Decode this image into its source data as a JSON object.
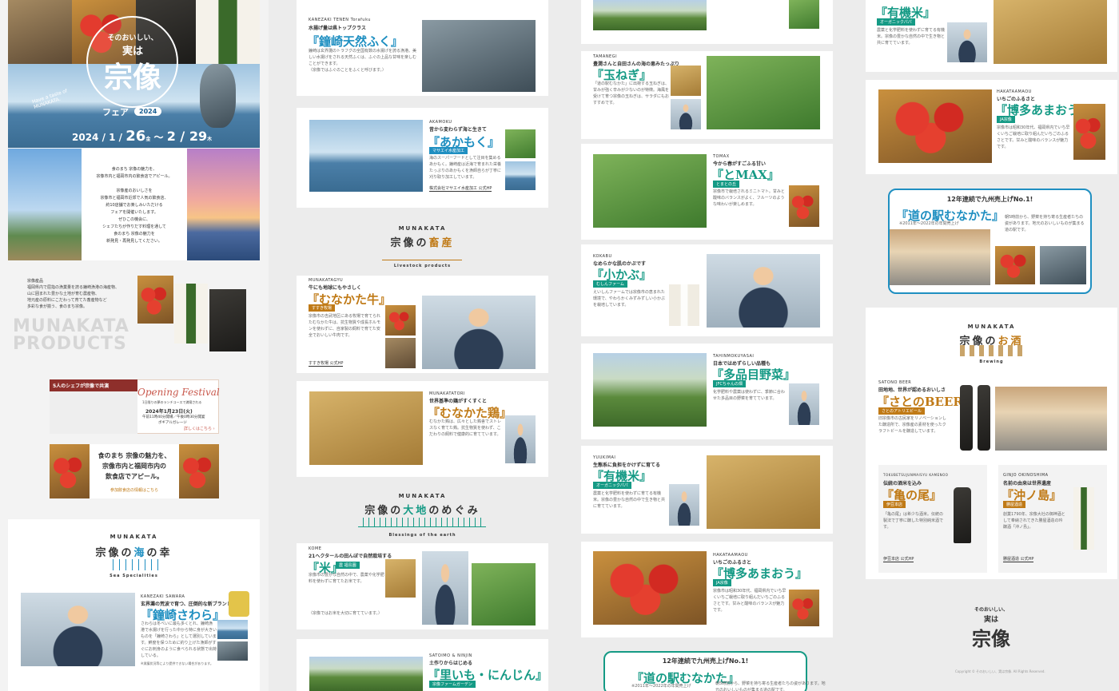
{
  "hero": {
    "catch": "そのおいしい、",
    "jitsuha": "実は",
    "munakata": "宗像",
    "fair": "フェア",
    "year": "2024",
    "date1": "2024 / 1",
    "date2": "26",
    "dow1": "金",
    "sep": "〜",
    "date3": "2 / 29",
    "dow2": "木",
    "taste": "Have a taste of MUNAKATA."
  },
  "intro": {
    "lines": [
      "食のまち 宗像の魅力を、",
      "宗像市内と福岡市内の飲食店でアピール。",
      "",
      "宗像産のおいしさを",
      "宗像市と福岡市近郊で人気の飲食店、",
      "約10店舗でお楽しみいただける",
      "フェアを開催いたします。",
      "ぜひこの機会に、",
      "シェフたちが作りだす料理を通して",
      "食のまち 宗像の魅力を",
      "新発見・再発見してください。"
    ]
  },
  "products": {
    "label": "宗像産品",
    "text": [
      "福岡県内で屈指の漁業量を誇る鐘崎漁港の海産物、",
      "山に囲まれた豊かな土地が育む農産物、",
      "地元産の原料にこだわって育てた畜産物など",
      "多彩な食が揃う、食のまち宗像。"
    ],
    "big1": "MUNAKATA",
    "big2": "PRODUCTS"
  },
  "banner1": {
    "chefs": "5人のシェフが宗像で共演",
    "event": "Opening Festival",
    "sub": "1日限りの夢のランチコースで満喫される",
    "date": "2024年1月23日",
    "dow": "火",
    "time": "午前11時40分開場／午後0時30分開宴",
    "venue": "ボギアルガレージ",
    "more": "詳しくはこちら ›"
  },
  "banner2": {
    "l1": "食のまち 宗像の魅力を、",
    "l2": "宗像市内と福岡市内の",
    "l3": "飲食店でアピール。",
    "more": "参加飲食店の情報はこちら"
  },
  "sea": {
    "en": "MUNAKATA",
    "jp1": "宗像の",
    "jp2": "海",
    "jp3": "の幸",
    "sub": "Sea Specialities"
  },
  "sawara": {
    "roman": "KANEZAKI SAWARA",
    "catch": "玄界灘の荒波で育つ、圧倒的な新ブランド",
    "name": "『鐘崎さわら』",
    "text": "さわらは冬べいに最も多くとれ、鐘崎漁港で水揚げを行った中から特に身が大きいものを「鐘崎さわら」として選別しています。鮮度を保つために釣り上げた漁師がすぐにお刺身のように食べられる状態で出荷している。",
    "note": "※漁獲状況等により提供できない場合があります。"
  },
  "fugu": {
    "roman": "KANEZAKI TENEN Torafuku",
    "catch": "水揚げ量は県トップクラス",
    "name": "『鐘崎天然ふく』",
    "text": "鐘崎は玄界灘のトラフグの全国有数の水揚げを誇る漁港。美しい水揚げをされる天然ふくは、ふぐの上品な甘味を楽しむことができます。",
    "note": "（宗像ではふぐのことをふくと呼びます。）"
  },
  "akamoku": {
    "roman": "AKAMOKU",
    "catch": "昔から変わらず海と生きて",
    "name": "『あかもく』",
    "badge": "マサエイ水産加工",
    "text": "海のスーパーフードとして注目を集めるあかもく。鐘崎産は近海で育まれた栄養たっぷりのあかもくを漁師自らが丁寧に刈り取り加工しています。",
    "link": "株式会社マサエイ水産加工 公式HP"
  },
  "livestock": {
    "en": "MUNAKATA",
    "jp1": "宗像の",
    "jp2": "畜産",
    "sub": "Livestock products"
  },
  "gyu": {
    "roman": "MUNAKATAGYU",
    "catch": "牛にも地球にもやさしく",
    "name": "『むなかた牛』",
    "badge": "すすき牧場",
    "text": "宗像市の吉武地区にある牧場で育てられたむなかた牛は、抗生物質や成長ホルモンを使わずに、自家製の飼料で育てた安全でおいしい牛肉です。",
    "link": "すすき牧場 公式HP"
  },
  "tori": {
    "roman": "MUNAKATATORI",
    "catch": "世界基準の鶏がすくすくと",
    "name": "『むなかた鶏』",
    "text": "むなかた鶏は、広々とした鶏舎でストレスなく育てた鶏。抗生物質を使わず、こだわりの飼料で健康的に育てています。"
  },
  "earth": {
    "en": "MUNAKATA",
    "jp1": "宗像の",
    "jp2": "大地",
    "jp3": "のめぐみ",
    "sub": "Blessings of the earth"
  },
  "kome": {
    "roman": "KOME",
    "catch": "21ヘクタールの田んぼで自然栽培する",
    "name": "『米』",
    "badge": "農 福島園",
    "text": "宗像市の豊かな自然の中で、農薬や化学肥料を使わずに育てたお米です。",
    "note": "（宗像ではお米を大切に育てています。）"
  },
  "satoimo": {
    "roman": "SATOIMO & NINJIN",
    "catch": "土作りからはじめる",
    "name": "『里いも・にんじん』",
    "badge": "宗像ファームガーデン"
  },
  "tamanegi": {
    "roman": "TAMANEGI",
    "catch": "豊潤さんと自田さんの海の恵みたっぷり",
    "name": "『玉ねぎ』",
    "text": "「道の駅むなかた」に出荷する玉ねぎは、甘みが強く辛みが少ないのが特徴。海風を受けて育つ宗像の玉ねぎは、サラダにもおすすめです。"
  },
  "tomax": {
    "roman": "TOMAX",
    "catch": "今から春がすごふる甘い",
    "name": "『とMAX』",
    "badge": "とまとの丘",
    "text": "宗像市で栽培されるミニトマト。甘みと酸味のバランスがよく、フルーツのような味わいが楽しめます。"
  },
  "kokabu": {
    "roman": "KOKABU",
    "catch": "なめらかな肌のかぶです",
    "name": "『小かぶ』",
    "badge": "むしんファーム",
    "text": "えいしんファームでは宗像市の恵まれた環境で、やわらかくみずみずしい小かぶを栽培しています。"
  },
  "tahinmoku": {
    "roman": "TAHINMOKUYASAI",
    "catch": "日本ではめずらしい品種も",
    "name": "『多品目野菜』",
    "badge": "JFCちゃんの畑",
    "text": "化学肥料や農薬は使わずに、季節に合わせた多品目の野菜を育てています。"
  },
  "yukimai": {
    "roman": "YUUKIMAI",
    "catch": "生態系に負担をかけずに育てる",
    "name": "『有機米』",
    "badge": "オーガニックパパ",
    "text": "農薬と化学肥料を使わずに育てる有機米。宗像の豊かな自然の中で生き物と共に育てています。"
  },
  "amaou": {
    "roman": "HAKATAAMAOU",
    "catch": "いちごのふるさと",
    "name": "『博多あまおう』",
    "badge": "JA宗像",
    "text": "宗像市は昭和30年代、福岡県内でいち早くいちご栽培に取り組んだいちごのふるさとです。甘みと酸味のバランスが魅力です。"
  },
  "michi": {
    "top": "12年連続で九州売上げNo.1!",
    "name": "『道の駅むなかた』",
    "note": "※2011年〜2022年の年間売上げ",
    "text": "朝5時前から、野菜を持ち寄る生産者たちの姿があります。地元のおいしいものが集まる道の駅です。"
  },
  "sake": {
    "en": "MUNAKATA",
    "jp1": "宗像の",
    "jp2": "お酒",
    "sub": "Brewing"
  },
  "beer": {
    "roman": "SATONO BEER",
    "catch": "田地地、世界が認めるおいしさ",
    "name": "『さとのBEER』",
    "badge": "さとのアトリエビール",
    "text": "旧宗像市の古民家をリノベーションした醸造所で、宗像産の素材を使ったクラフトビールを醸造しています。"
  },
  "kamenoo": {
    "roman": "TOKUBETSUJUNMAISYU KAMENOO",
    "catch": "伝統の酒米を込み",
    "name": "『亀の尾』",
    "badge": "伊豆本店",
    "text": "「亀の尾」は希少な酒米。伝統の製法で丁寧に醸した特別純米酒です。",
    "link": "伊豆本店 公式HP"
  },
  "okinoshima": {
    "roman": "GINJO OKINOSHIMA",
    "catch": "名前の由来は世界遺産",
    "name": "『沖ノ島』",
    "badge": "勝屋酒造",
    "text": "創業1790年、宗像大社の御神酒として奉納されてきた勝屋酒造の吟醸酒「沖ノ島」。",
    "link": "勝屋酒造 公式HP"
  },
  "footer": {
    "copyright": "Copyright © そのおいしい、実は宗像. All Rights Reserved."
  }
}
